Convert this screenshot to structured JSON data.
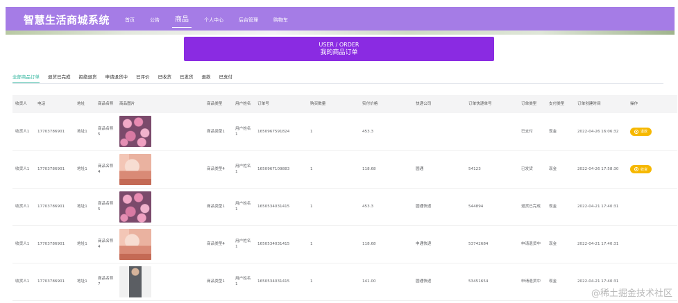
{
  "header": {
    "logo": "智慧生活商城系统",
    "nav": [
      {
        "label": "首页",
        "active": false
      },
      {
        "label": "公告",
        "active": false
      },
      {
        "label": "商品",
        "active": true
      },
      {
        "label": "个人中心",
        "active": false
      },
      {
        "label": "后台管理",
        "active": false
      },
      {
        "label": "购物车",
        "active": false
      }
    ],
    "colors": {
      "header_bg": "#a57ce6",
      "banner_bg": "#8a2be2",
      "accent": "#2bb39b",
      "button": "#f6b800"
    }
  },
  "banner": {
    "en": "USER / ORDER",
    "cn": "我的商品订单"
  },
  "tabs": [
    {
      "label": "全部商品订单",
      "active": true
    },
    {
      "label": "退货已完成",
      "active": false
    },
    {
      "label": "拒绝退货",
      "active": false
    },
    {
      "label": "申请退货中",
      "active": false
    },
    {
      "label": "已评价",
      "active": false
    },
    {
      "label": "已收货",
      "active": false
    },
    {
      "label": "已发货",
      "active": false
    },
    {
      "label": "退款",
      "active": false
    },
    {
      "label": "已支付",
      "active": false
    }
  ],
  "table": {
    "headers": [
      "收货人",
      "电话",
      "地址",
      "商品名称",
      "商品图片",
      "商品类型",
      "用户姓名",
      "订单号",
      "购买数量",
      "实付价格",
      "快递公司",
      "订单快递单号",
      "订单类型",
      "支付类型",
      "订单创建时间",
      "操作"
    ],
    "rows": [
      {
        "receiver": "收货人1",
        "phone": "17703786901",
        "address": "地址1",
        "product": "商品名称5",
        "image": "roses-icon",
        "type": "商品类型1",
        "user": "用户姓名1",
        "order_no": "1650967591824",
        "qty": "1",
        "price": "453.3",
        "courier": "",
        "tracking": "",
        "status": "已支付",
        "pay": "现金",
        "created": "2022-04-26 16:06:32",
        "action": "退款"
      },
      {
        "receiver": "收货人1",
        "phone": "17703786901",
        "address": "地址1",
        "product": "商品名称4",
        "image": "cosmetics-icon",
        "type": "商品类型4",
        "user": "用户姓名1",
        "order_no": "1650967109883",
        "qty": "1",
        "price": "118.68",
        "courier": "圆通",
        "tracking": "54123",
        "status": "已发货",
        "pay": "现金",
        "created": "2022-04-26 17:58:30",
        "action": "收货"
      },
      {
        "receiver": "收货人1",
        "phone": "17703786901",
        "address": "地址1",
        "product": "商品名称5",
        "image": "roses-icon",
        "type": "商品类型1",
        "user": "用户姓名1",
        "order_no": "1650534031415",
        "qty": "1",
        "price": "453.3",
        "courier": "圆通快递",
        "tracking": "544894",
        "status": "退货已完成",
        "pay": "现金",
        "created": "2022-04-21 17:40:31",
        "action": ""
      },
      {
        "receiver": "收货人1",
        "phone": "17703786901",
        "address": "地址1",
        "product": "商品名称4",
        "image": "cosmetics-icon",
        "type": "商品类型4",
        "user": "用户姓名1",
        "order_no": "1650534031415",
        "qty": "1",
        "price": "118.68",
        "courier": "申通快递",
        "tracking": "53742684",
        "status": "申请退货中",
        "pay": "现金",
        "created": "2022-04-21 17:40:31",
        "action": ""
      },
      {
        "receiver": "收货人1",
        "phone": "17703786901",
        "address": "地址1",
        "product": "商品名称7",
        "image": "person-icon",
        "type": "商品类型1",
        "user": "用户姓名1",
        "order_no": "1650534031415",
        "qty": "1",
        "price": "141.00",
        "courier": "圆通快递",
        "tracking": "53451654",
        "status": "申请退货中",
        "pay": "现金",
        "created": "2022-04-21 17:40:31",
        "action": ""
      }
    ]
  },
  "watermark": "@稀土掘金技术社区"
}
